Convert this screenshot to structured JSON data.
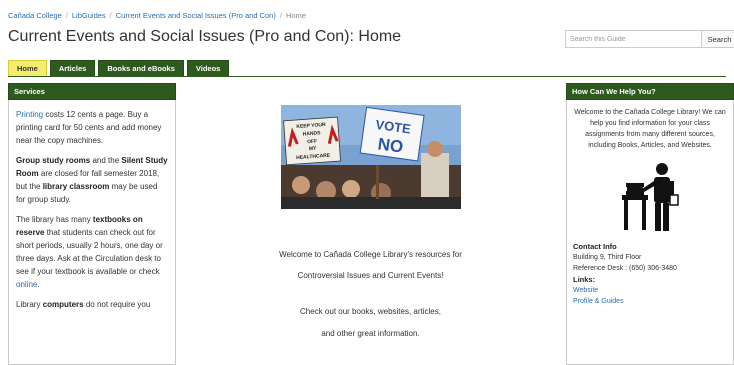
{
  "breadcrumb": {
    "items": [
      "Cañada College",
      "LibGuides",
      "Current Events and Social Issues (Pro and Con)",
      "Home"
    ]
  },
  "page": {
    "title": "Current Events and Social Issues (Pro and Con): Home"
  },
  "search": {
    "placeholder": "Search this Guide",
    "button_label": "Search"
  },
  "tabs": [
    {
      "label": "Home",
      "active": true
    },
    {
      "label": "Articles",
      "active": false
    },
    {
      "label": "Books and eBooks",
      "active": false
    },
    {
      "label": "Videos",
      "active": false
    }
  ],
  "services": {
    "header": "Services",
    "printing_link": "Printing",
    "printing_text": " costs 12 cents a page. Buy a printing card for 50 cents and add money near the copy machines.",
    "group_b1": "Group study rooms",
    "group_t1": " and the ",
    "group_b2": "Silent Study Room",
    "group_t2": " are closed for fall semester 2018, but the ",
    "group_b3": "library classroom",
    "group_t3": " may be used for group study.",
    "reserve_t1": "The library has many ",
    "reserve_b1": "textbooks on reserve",
    "reserve_t2": " that students can check out for short periods, usually 2 hours, one day or three days. Ask at the Circulation desk to see if your textbook is available or check ",
    "reserve_link": "online",
    "reserve_t3": ".",
    "computers_t1": "Library ",
    "computers_b1": "computers",
    "computers_t2": " do not require you"
  },
  "center": {
    "photo_sign_left": "KEEP YOUR HANDS OFF MY HEALTHCARE",
    "photo_sign_vote": "VOTE",
    "photo_sign_no": "NO",
    "line1": "Welcome to Cañada College Library's resources for",
    "line2": "Controversial Issues and Current Events!",
    "line3": "Check out our books, websites, articles,",
    "line4": "and other great information."
  },
  "help": {
    "header": "How Can We Help You?",
    "welcome": "Welcome to the Cañada College Library! We can help you find information for your class assignments from many different sources, including Books, Articles, and Websites.",
    "contact_label": "Contact Info",
    "building": "Building 9, Third Floor",
    "reference_desk": "Reference Desk : (650) 306-3480",
    "links_label": "Links:",
    "link_website": "Website",
    "link_profile": "Profile & Guides"
  },
  "colors": {
    "tab_green": "#2f5a1f",
    "tab_active": "#f6ec6c",
    "link_blue": "#2a6fb0"
  }
}
